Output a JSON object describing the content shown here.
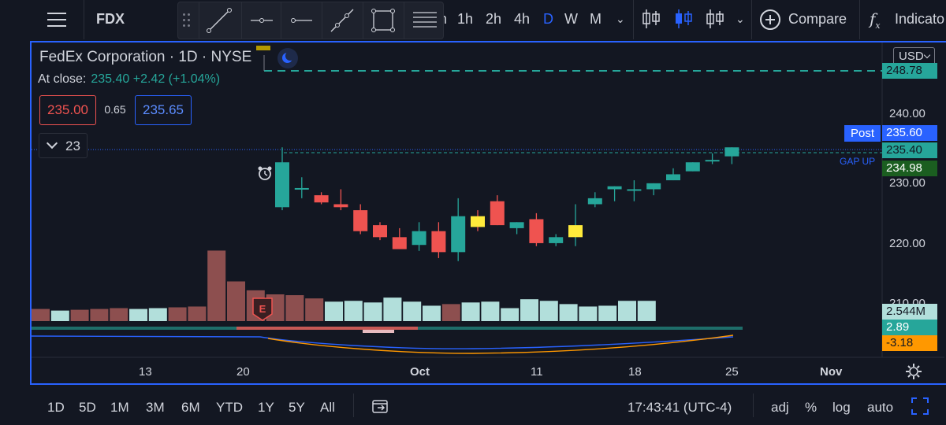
{
  "header": {
    "symbol": "FDX",
    "timeframes": [
      "m",
      "1h",
      "2h",
      "4h",
      "D",
      "W",
      "M"
    ],
    "active_timeframe": "D",
    "compare_label": "Compare",
    "indicators_label": "Indicato"
  },
  "drawing_tools": [
    "trend-line",
    "horizontal-ray",
    "horizontal-line",
    "extended-line",
    "rectangle",
    "parallel-channel"
  ],
  "legend": {
    "title": "FedEx Corporation · 1D · NYSE",
    "close_label": "At close:",
    "close_value": "235.40 +2.42 (+1.04%)",
    "bid": "235.00",
    "spread": "0.65",
    "ask": "235.65",
    "indicator_count": "23"
  },
  "price_scale": {
    "currency": "USD",
    "ticks": [
      "240.00",
      "230.00",
      "220.00",
      "210.00"
    ],
    "labels": {
      "alert_level": "248.78",
      "post_price": "235.60",
      "last_close": "235.40",
      "ma_value": "234.98",
      "volume": "2.544M",
      "macd": "2.89",
      "signal": "-3.18"
    },
    "post_tag": "Post",
    "gap_label": "GAP UP"
  },
  "time_axis": {
    "labels": [
      "13",
      "20",
      "Oct",
      "11",
      "18",
      "25",
      "Nov"
    ],
    "bold_label": "Oct"
  },
  "bottom": {
    "ranges": [
      "1D",
      "5D",
      "1M",
      "3M",
      "6M",
      "YTD",
      "1Y",
      "5Y",
      "All"
    ],
    "clock": "17:43:41 (UTC-4)",
    "options": [
      "adj",
      "%",
      "log",
      "auto"
    ]
  },
  "colors": {
    "up": "#26a69a",
    "down": "#ef5350",
    "highlight": "#ffeb3b",
    "accent": "#2962ff",
    "background": "#131722"
  },
  "earnings_marker": "E",
  "chart_data": {
    "type": "candlestick",
    "title": "",
    "ylim": [
      205,
      251
    ],
    "candles": [
      {
        "o": 226.0,
        "h": 236.0,
        "l": 225.5,
        "c": 233.5
      },
      {
        "o": 229.0,
        "h": 231.0,
        "l": 227.5,
        "c": 229.2
      },
      {
        "o": 228.0,
        "h": 228.5,
        "l": 226.5,
        "c": 226.8
      },
      {
        "o": 226.5,
        "h": 229.0,
        "l": 225.5,
        "c": 226.0
      },
      {
        "o": 225.5,
        "h": 226.5,
        "l": 221.5,
        "c": 222.0
      },
      {
        "o": 223.0,
        "h": 223.5,
        "l": 220.5,
        "c": 221.0
      },
      {
        "o": 221.0,
        "h": 222.5,
        "l": 219.0,
        "c": 219.0
      },
      {
        "o": 219.7,
        "h": 223.5,
        "l": 218.7,
        "c": 222.0
      },
      {
        "o": 222.0,
        "h": 223.5,
        "l": 217.5,
        "c": 218.5
      },
      {
        "o": 218.5,
        "h": 227.5,
        "l": 217.0,
        "c": 224.5
      },
      {
        "o": 224.5,
        "h": 225.5,
        "l": 222.0,
        "c": 222.7
      },
      {
        "o": 227.0,
        "h": 228.0,
        "l": 223.0,
        "c": 223.0
      },
      {
        "o": 222.5,
        "h": 223.5,
        "l": 221.5,
        "c": 223.5
      },
      {
        "o": 224.0,
        "h": 225.0,
        "l": 219.5,
        "c": 220.0
      },
      {
        "o": 220.0,
        "h": 221.5,
        "l": 219.5,
        "c": 221.0
      },
      {
        "o": 221.0,
        "h": 226.5,
        "l": 219.5,
        "c": 223.0
      },
      {
        "o": 226.5,
        "h": 228.5,
        "l": 226.0,
        "c": 227.5
      },
      {
        "o": 229.0,
        "h": 229.5,
        "l": 227.0,
        "c": 229.5
      },
      {
        "o": 229.0,
        "h": 230.5,
        "l": 227.0,
        "c": 229.0
      },
      {
        "o": 229.0,
        "h": 230.0,
        "l": 228.0,
        "c": 230.0
      },
      {
        "o": 230.5,
        "h": 232.5,
        "l": 230.5,
        "c": 231.5
      },
      {
        "o": 232.0,
        "h": 233.5,
        "l": 232.0,
        "c": 233.5
      },
      {
        "o": 233.7,
        "h": 235.0,
        "l": 233.2,
        "c": 233.9
      },
      {
        "o": 234.5,
        "h": 236.0,
        "l": 233.2,
        "c": 236.0
      }
    ],
    "highlighted_candles": [
      10,
      15
    ],
    "volume": [
      1.5,
      1.3,
      1.4,
      1.5,
      1.6,
      1.5,
      1.6,
      1.7,
      1.8,
      8.7,
      4.9,
      3.8,
      3.3,
      3.2,
      2.8,
      2.4,
      2.5,
      2.3,
      2.9,
      2.4,
      1.9,
      2.1,
      2.3,
      2.4,
      1.6,
      2.7,
      2.5,
      2.1,
      1.8,
      1.9,
      2.5,
      2.5
    ],
    "volume_colors": [
      "down",
      "up",
      "down",
      "down",
      "down",
      "up",
      "up",
      "down",
      "down",
      "down",
      "down",
      "down",
      "down",
      "down",
      "down",
      "up",
      "up",
      "up",
      "up",
      "up",
      "up",
      "down",
      "up",
      "up",
      "up",
      "up",
      "up",
      "up",
      "up",
      "up",
      "up",
      "up"
    ]
  }
}
